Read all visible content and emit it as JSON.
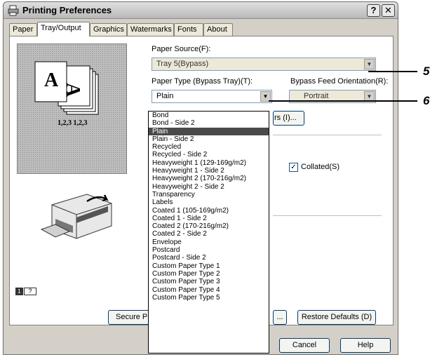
{
  "window": {
    "title": "Printing Preferences",
    "help_label": "?",
    "close_label": "✕"
  },
  "tabs": [
    {
      "label": "Paper"
    },
    {
      "label": "Tray/Output"
    },
    {
      "label": "Graphics"
    },
    {
      "label": "Watermarks"
    },
    {
      "label": "Fonts"
    },
    {
      "label": "About"
    }
  ],
  "preview": {
    "collate_text": "1,2,3  1,2,3",
    "page_icon": "A",
    "help_number": "1",
    "help_label": "?"
  },
  "paper_source": {
    "label": "Paper Source(F):",
    "value": "Tray 5(Bypass)"
  },
  "paper_type": {
    "label": "Paper Type (Bypass Tray)(T):",
    "value": "Plain",
    "options": [
      "Bond",
      "Bond - Side 2",
      "Plain",
      "Plain - Side 2",
      "Recycled",
      "Recycled - Side 2",
      "Heavyweight 1 (129-169g/m2)",
      "Heavyweight 1 - Side 2",
      "Heavyweight 2 (170-216g/m2)",
      "Heavyweight 2 - Side 2",
      "Transparency",
      "Labels",
      "Coated 1 (105-169g/m2)",
      "Coated 1 - Side 2",
      "Coated 2 (170-216g/m2)",
      "Coated 2 - Side 2",
      "Envelope",
      "Postcard",
      "Postcard - Side 2",
      "Custom Paper Type 1",
      "Custom Paper Type 2",
      "Custom Paper Type 3",
      "Custom Paper Type 4",
      "Custom Paper Type 5"
    ],
    "selected_index": 2
  },
  "feed_orientation": {
    "label": "Bypass Feed Orientation(R):",
    "value": "Portrait"
  },
  "partial_button": "rs (I)...",
  "collated": {
    "label": "Collated(S)",
    "checked": true
  },
  "buttons": {
    "secure_print": "Secure Prin",
    "ellipsis": "...",
    "restore_defaults": "Restore Defaults (D)",
    "cancel": "Cancel",
    "help": "Help"
  },
  "callouts": [
    "5",
    "6"
  ]
}
